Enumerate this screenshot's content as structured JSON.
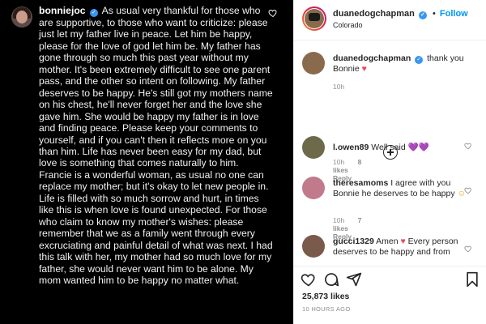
{
  "left_post": {
    "username": "bonniejoc",
    "body": "As usual very thankful for those who are supportive, to those who want to criticize: please just let my father live in peace. Let him be happy, please for the love of god let him be. My father has gone through so much this past year without my mother. It's been extremely difficult to see one parent pass, and the other so intent on following. My father deserves to be happy. He's still got my mothers name on his chest, he'll never forget her and the love she gave him. She would be happy my father is in love and finding peace. Please keep your comments to yourself, and if you can't then it reflects more on you than him. Life has never been easy for my dad, but love is something that comes naturally to him. Francie is a wonderful woman, as usual no one can replace my mother; but it's okay to let new people in. Life is filled with so much sorrow and hurt, in times like this is when love is found unexpected. For those who claim to know my mother's wishes: please remember that we as a family went through every excruciating and painful detail of what was next. I had this talk with her, my mother had so much love for my father, she would never want him to be alone. My mom wanted him to be happy no matter what."
  },
  "header": {
    "username": "duanedogchapman",
    "separator": "•",
    "follow_label": "Follow",
    "location": "Colorado",
    "more_label": "···"
  },
  "comments": [
    {
      "username": "duanedogchapman",
      "text": "thank you Bonnie",
      "emoji": "♥",
      "time": "10h",
      "likes": "",
      "reply": ""
    },
    {
      "username": "l.owen89",
      "text": "Well said",
      "emoji": "💜💜",
      "time": "10h",
      "likes": "8 likes",
      "reply": "Reply"
    },
    {
      "username": "theresamoms",
      "text": "I agree with you Bonnie he deserves to be happy",
      "emoji": "☺",
      "time": "10h",
      "likes": "7 likes",
      "reply": "Reply"
    },
    {
      "username": "gucci1329",
      "text": "Amen",
      "emoji": "♥",
      "text2": "Every person deserves to be happy and from",
      "time": "",
      "likes": "",
      "reply": ""
    }
  ],
  "footer": {
    "likes": "25,873 likes",
    "timestamp": "10 HOURS AGO"
  },
  "icons": {
    "left_heart": "heart-outline-icon",
    "verified": "verified-badge-icon",
    "load_more": "plus-circle-icon",
    "like": "heart-icon",
    "comment": "comment-icon",
    "share": "share-icon",
    "save": "bookmark-icon"
  },
  "colors": {
    "accent": "#0095f6",
    "verified": "#3897f0",
    "heart": "#ed4956",
    "muted": "#8e8e8e"
  }
}
